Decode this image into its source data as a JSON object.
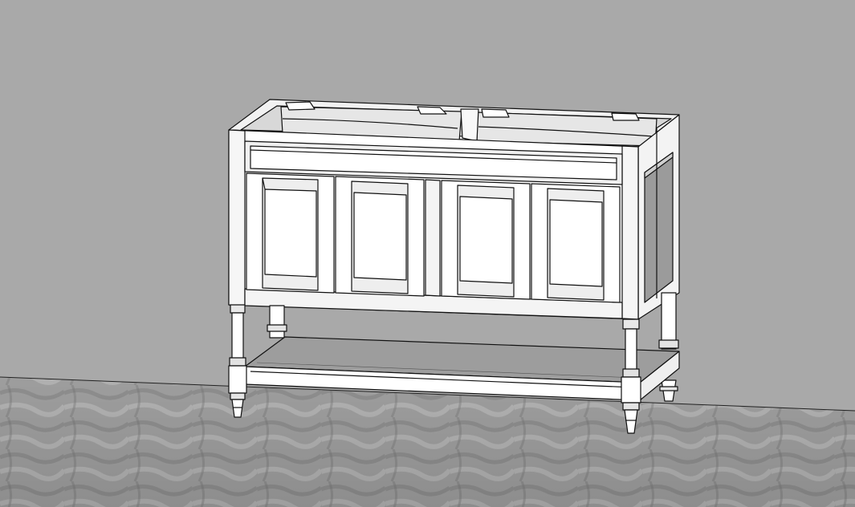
{
  "scene": {
    "subject": "vanity-cabinet-model",
    "colors": {
      "wall": "#a9a9a9",
      "floor_light": "#b9b9b9",
      "floor_dark": "#7c7c7c",
      "wood_face": "#ffffff",
      "wood_shade": "#c8c8c8",
      "wood_dark": "#8f8f8f",
      "side_panel": "#9a9a9a",
      "edge": "#111111"
    },
    "cabinet": {
      "door_count": 4,
      "leg_count": 4,
      "sink_bowls": 2,
      "has_bottom_shelf": true
    }
  }
}
